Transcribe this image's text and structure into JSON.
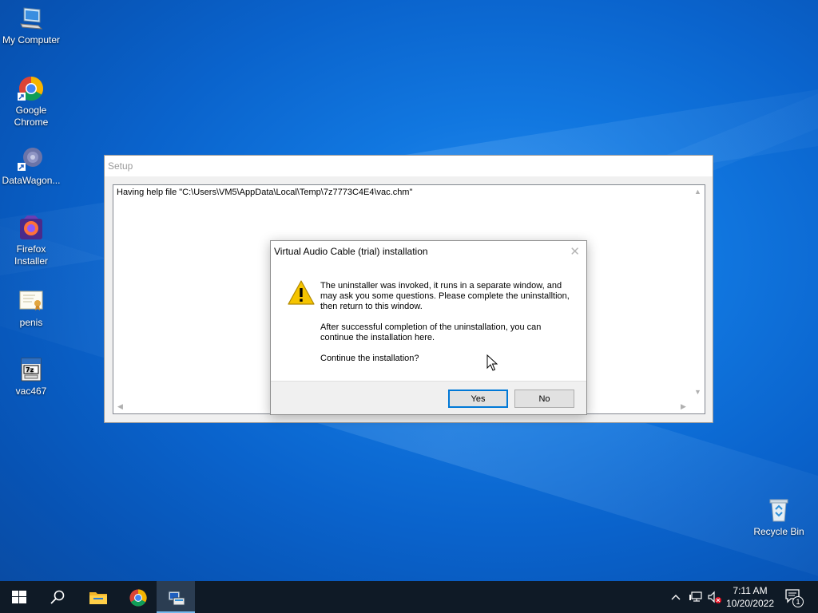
{
  "desktop": {
    "icons": [
      {
        "label": "My Computer",
        "icon": "computer-icon"
      },
      {
        "label": "Google Chrome",
        "icon": "chrome-icon"
      },
      {
        "label": "DataWagon...",
        "icon": "datawagon-icon"
      },
      {
        "label": "Firefox Installer",
        "icon": "firefox-installer-icon"
      },
      {
        "label": "penis",
        "icon": "certificate-file-icon"
      },
      {
        "label": "vac467",
        "icon": "7z-archive-icon"
      },
      {
        "label": "Recycle Bin",
        "icon": "recycle-bin-icon"
      }
    ]
  },
  "setup_window": {
    "title": "Setup",
    "log_line": "Having help file \"C:\\Users\\VM5\\AppData\\Local\\Temp\\7z7773C4E4\\vac.chm\""
  },
  "dialog": {
    "title": "Virtual Audio Cable (trial) installation",
    "icon": "warning-icon",
    "message_1": "The uninstaller was invoked, it runs in a separate window, and may ask you some questions. Please complete the uninstalltion, then return to this window.",
    "message_2": "After successful completion of the uninstallation, you can continue the installation here.",
    "message_3": "Continue the installation?",
    "yes_label": "Yes",
    "no_label": "No"
  },
  "taskbar": {
    "items": [
      "start-icon",
      "search-icon",
      "file-explorer-icon",
      "chrome-icon",
      "setup-app-icon"
    ],
    "time": "7:11 AM",
    "date": "10/20/2022",
    "notification_count": "1",
    "colors": {
      "background": "#0f1a26",
      "active_item": "#2b3d52",
      "accent": "#76b9ed"
    }
  }
}
